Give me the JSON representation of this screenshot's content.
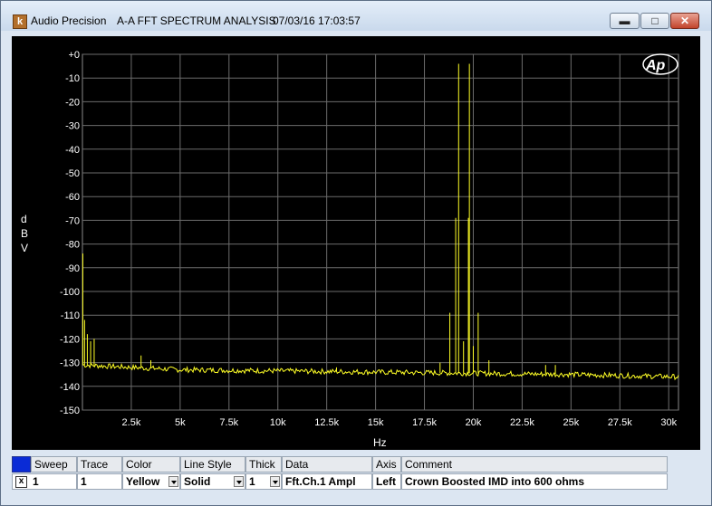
{
  "window": {
    "app_name": "Audio Precision",
    "title": "A-A FFT SPECTRUM ANALYSIS",
    "datetime": "07/03/16 17:03:57",
    "icon": "ap-app-icon",
    "minimize_icon": "minimize-icon",
    "maximize_icon": "maximize-icon",
    "close_icon": "close-icon"
  },
  "chart_data": {
    "type": "line",
    "ylabel": "dBV",
    "xlabel": "Hz",
    "xlim": [
      0,
      30500
    ],
    "ylim": [
      -150,
      0
    ],
    "y_ticks": [
      "+0",
      "-10",
      "-20",
      "-30",
      "-40",
      "-50",
      "-60",
      "-70",
      "-80",
      "-90",
      "-100",
      "-110",
      "-120",
      "-130",
      "-140",
      "-150"
    ],
    "x_ticks": [
      "2.5k",
      "5k",
      "7.5k",
      "10k",
      "12.5k",
      "15k",
      "17.5k",
      "20k",
      "22.5k",
      "25k",
      "27.5k",
      "30k"
    ],
    "grid": true,
    "logo": "Ap",
    "series": [
      {
        "color": "#ffff26",
        "noise_floor": [
          [
            20,
            -131
          ],
          [
            2500,
            -132
          ],
          [
            5000,
            -133
          ],
          [
            10000,
            -133.5
          ],
          [
            15000,
            -134
          ],
          [
            20000,
            -134.5
          ],
          [
            25000,
            -135
          ],
          [
            30500,
            -136
          ]
        ],
        "spikes": [
          {
            "x": 20,
            "y": -84
          },
          {
            "x": 110,
            "y": -112
          },
          {
            "x": 250,
            "y": -118
          },
          {
            "x": 420,
            "y": -121
          },
          {
            "x": 600,
            "y": -120
          },
          {
            "x": 3000,
            "y": -127
          },
          {
            "x": 3500,
            "y": -129
          },
          {
            "x": 13000,
            "y": -132
          },
          {
            "x": 18300,
            "y": -130
          },
          {
            "x": 18800,
            "y": -109
          },
          {
            "x": 19100,
            "y": -69
          },
          {
            "x": 19250,
            "y": -4
          },
          {
            "x": 19500,
            "y": -121
          },
          {
            "x": 19750,
            "y": -69
          },
          {
            "x": 19800,
            "y": -4
          },
          {
            "x": 20000,
            "y": -123
          },
          {
            "x": 20250,
            "y": -109
          },
          {
            "x": 20800,
            "y": -129
          },
          {
            "x": 23700,
            "y": -131
          },
          {
            "x": 24200,
            "y": -131
          }
        ]
      }
    ]
  },
  "legend": {
    "headers": [
      "Sweep",
      "Trace",
      "Color",
      "Line Style",
      "Thick",
      "Data",
      "Axis",
      "Comment"
    ],
    "row": {
      "checked": "x",
      "sweep": "1",
      "trace": "1",
      "color": "Yellow",
      "line_style": "Solid",
      "thick": "1",
      "data": "Fft.Ch.1 Ampl",
      "axis": "Left",
      "comment": "Crown Boosted IMD into 600 ohms"
    }
  }
}
